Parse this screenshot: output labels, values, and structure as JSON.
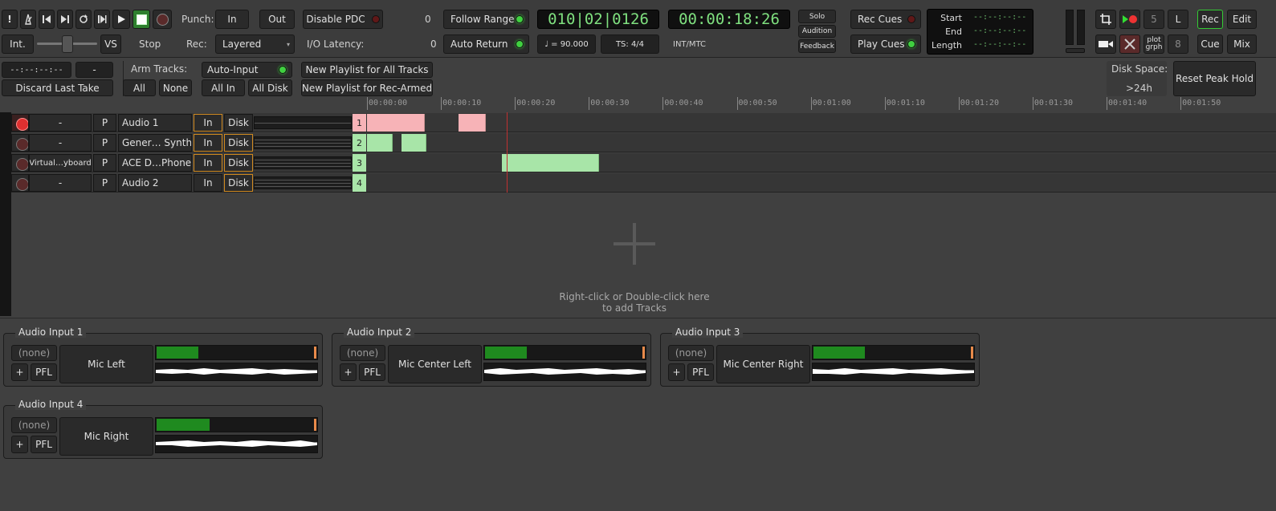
{
  "transport": {
    "int_label": "Int.",
    "vs_label": "VS",
    "stop_label": "Stop",
    "punch_label": "Punch:",
    "punch_in": "In",
    "punch_out": "Out",
    "rec_label": "Rec:",
    "rec_mode": "Layered",
    "disable_pdc": "Disable PDC",
    "pdc_value": "0",
    "io_latency_label": "I/O Latency:",
    "io_latency_value": "0",
    "follow_range": "Follow Range",
    "auto_return": "Auto Return",
    "bbt_clock": "010|02|0126",
    "tempo": "♩ = 90.000",
    "ts": "TS: 4/4",
    "time_clock": "00:00:18:26",
    "sync": "INT/MTC",
    "solo": "Solo",
    "audition": "Audition",
    "feedback": "Feedback",
    "rec_cues": "Rec Cues",
    "play_cues": "Play Cues",
    "range": {
      "start_label": "Start",
      "start_value": "--:--:--:--",
      "end_label": "End",
      "end_value": "--:--:--:--",
      "length_label": "Length",
      "length_value": "--:--:--:--"
    },
    "n5": "5",
    "l_btn": "L",
    "n8": "8",
    "plot_grph": "plot grph",
    "rec_tab": "Rec",
    "edit_tab": "Edit",
    "cue_tab": "Cue",
    "mix_tab": "Mix"
  },
  "rec_toolbar": {
    "time_display": "--:--:--:--",
    "dash": "-",
    "discard": "Discard Last Take",
    "arm_tracks": "Arm Tracks:",
    "all": "All",
    "none": "None",
    "auto_input": "Auto-Input",
    "all_in": "All In",
    "all_disk": "All Disk",
    "new_playlist_all": "New Playlist for All Tracks",
    "new_playlist_armed": "New Playlist for Rec-Armed",
    "disk_space_label": "Disk Space:",
    "disk_space_value": ">24h",
    "reset_peak": "Reset Peak Hold"
  },
  "ruler": [
    "00:00:00",
    "00:00:10",
    "00:00:20",
    "00:00:30",
    "00:00:40",
    "00:00:50",
    "00:01:00",
    "00:01:10",
    "00:01:20",
    "00:01:30",
    "00:01:40",
    "00:01:50"
  ],
  "tracks": [
    {
      "input": "-",
      "p": "P",
      "name": "Audio 1",
      "in": "In",
      "disk": "Disk",
      "num": "1",
      "armed": true,
      "in_orange": true,
      "disk_orange": false
    },
    {
      "input": "-",
      "p": "P",
      "name": "Gener… Synth",
      "in": "In",
      "disk": "Disk",
      "num": "2",
      "armed": false,
      "in_orange": true,
      "disk_orange": true
    },
    {
      "input": "Virtual…yboard",
      "p": "P",
      "name": "ACE D…Phone",
      "in": "In",
      "disk": "Disk",
      "num": "3",
      "armed": false,
      "in_orange": true,
      "disk_orange": true
    },
    {
      "input": "-",
      "p": "P",
      "name": "Audio 2",
      "in": "In",
      "disk": "Disk",
      "num": "4",
      "armed": false,
      "in_orange": false,
      "disk_orange": true
    }
  ],
  "add_tracks_hint_1": "Right-click or Double-click here",
  "add_tracks_hint_2": "to add Tracks",
  "inputs": [
    {
      "title": "Audio Input 1",
      "none": "(none)",
      "name": "Mic Left",
      "plus": "+",
      "pfl": "PFL",
      "level": 0.26
    },
    {
      "title": "Audio Input 2",
      "none": "(none)",
      "name": "Mic Center Left",
      "plus": "+",
      "pfl": "PFL",
      "level": 0.26
    },
    {
      "title": "Audio Input 3",
      "none": "(none)",
      "name": "Mic Center Right",
      "plus": "+",
      "pfl": "PFL",
      "level": 0.32
    },
    {
      "title": "Audio Input 4",
      "none": "(none)",
      "name": "Mic Right",
      "plus": "+",
      "pfl": "PFL",
      "level": 0.33
    }
  ]
}
